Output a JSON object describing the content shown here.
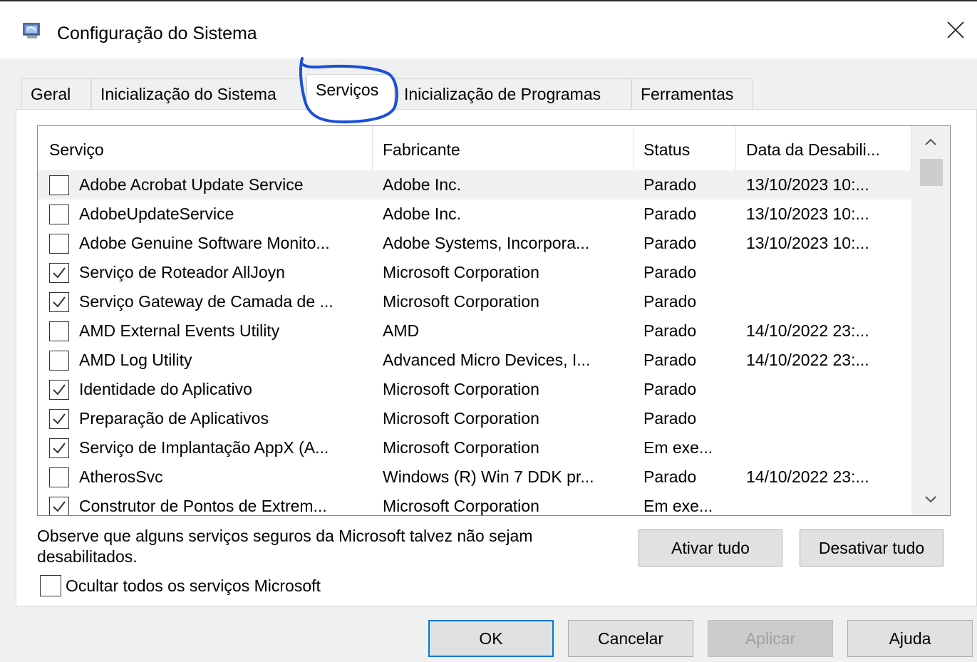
{
  "window": {
    "title": "Configuração do Sistema",
    "close_symbol": "✕"
  },
  "tabs": [
    {
      "label": "Geral"
    },
    {
      "label": "Inicialização do Sistema"
    },
    {
      "label": "Serviços"
    },
    {
      "label": "Inicialização de Programas"
    },
    {
      "label": "Ferramentas"
    }
  ],
  "active_tab": "Serviços",
  "services_list": {
    "columns": [
      "Serviço",
      "Fabricante",
      "Status",
      "Data da Desabili..."
    ],
    "rows": [
      {
        "checked": false,
        "service": "Adobe Acrobat Update Service",
        "manufacturer": "Adobe Inc.",
        "status": "Parado",
        "date": "13/10/2023 10:..."
      },
      {
        "checked": false,
        "service": "AdobeUpdateService",
        "manufacturer": "Adobe Inc.",
        "status": "Parado",
        "date": "13/10/2023 10:..."
      },
      {
        "checked": false,
        "service": "Adobe Genuine Software Monito...",
        "manufacturer": "Adobe Systems, Incorpora...",
        "status": "Parado",
        "date": "13/10/2023 10:..."
      },
      {
        "checked": true,
        "service": "Serviço de Roteador AllJoyn",
        "manufacturer": "Microsoft Corporation",
        "status": "Parado",
        "date": ""
      },
      {
        "checked": true,
        "service": "Serviço Gateway de Camada de ...",
        "manufacturer": "Microsoft Corporation",
        "status": "Parado",
        "date": ""
      },
      {
        "checked": false,
        "service": "AMD External Events Utility",
        "manufacturer": "AMD",
        "status": "Parado",
        "date": "14/10/2022 23:..."
      },
      {
        "checked": false,
        "service": "AMD Log Utility",
        "manufacturer": "Advanced Micro Devices, I...",
        "status": "Parado",
        "date": "14/10/2022 23:..."
      },
      {
        "checked": true,
        "service": "Identidade do Aplicativo",
        "manufacturer": "Microsoft Corporation",
        "status": "Parado",
        "date": ""
      },
      {
        "checked": true,
        "service": "Preparação de Aplicativos",
        "manufacturer": "Microsoft Corporation",
        "status": "Parado",
        "date": ""
      },
      {
        "checked": true,
        "service": "Serviço de Implantação AppX (A...",
        "manufacturer": "Microsoft Corporation",
        "status": "Em exe...",
        "date": ""
      },
      {
        "checked": false,
        "service": "AtherosSvc",
        "manufacturer": "Windows (R) Win 7 DDK pr...",
        "status": "Parado",
        "date": "14/10/2022 23:..."
      },
      {
        "checked": true,
        "service": "Construtor de Pontos de Extrem...",
        "manufacturer": "Microsoft Corporation",
        "status": "Em exe...",
        "date": ""
      }
    ]
  },
  "note_text": "Observe que alguns serviços seguros da Microsoft talvez não sejam desabilitados.",
  "hide_microsoft": {
    "label": "Ocultar todos os serviços Microsoft",
    "checked": false
  },
  "buttons": {
    "enable_all": "Ativar tudo",
    "disable_all": "Desativar tudo",
    "ok": "OK",
    "cancel": "Cancelar",
    "apply": "Aplicar",
    "help": "Ajuda"
  },
  "colors": {
    "accent": "#0078d7",
    "annotation": "#1a4fd8"
  }
}
